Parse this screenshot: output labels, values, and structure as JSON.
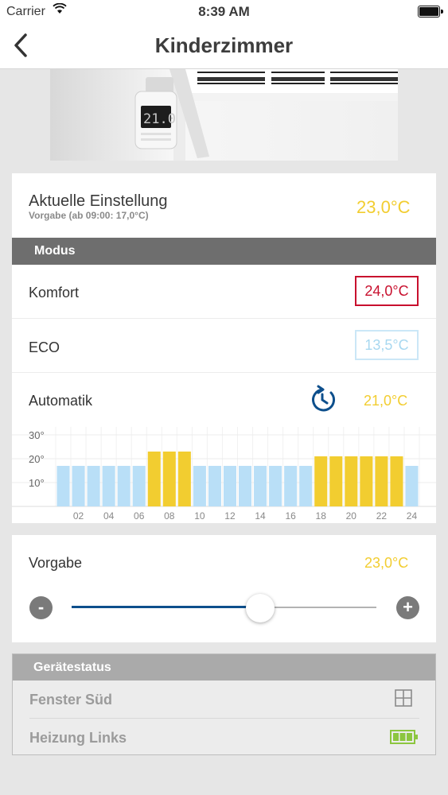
{
  "status_bar": {
    "carrier": "Carrier",
    "time": "8:39 AM"
  },
  "nav": {
    "title": "Kinderzimmer"
  },
  "current": {
    "title": "Aktuelle Einstellung",
    "subtitle": "Vorgabe (ab 09:00: 17,0°C)",
    "temp": "23,0°C"
  },
  "modus": {
    "header": "Modus",
    "komfort": {
      "label": "Komfort",
      "temp": "24,0°C"
    },
    "eco": {
      "label": "ECO",
      "temp": "13,5°C"
    },
    "automatik": {
      "label": "Automatik",
      "temp": "21,0°C"
    }
  },
  "chart_data": {
    "type": "bar",
    "ylabels": [
      "30°",
      "20°",
      "10°"
    ],
    "ylim": [
      0,
      30
    ],
    "categories": [
      "01",
      "02",
      "03",
      "04",
      "05",
      "06",
      "07",
      "08",
      "09",
      "10",
      "11",
      "12",
      "13",
      "14",
      "15",
      "16",
      "17",
      "18",
      "19",
      "20",
      "21",
      "22",
      "23",
      "24"
    ],
    "xtick_labels": [
      "02",
      "04",
      "06",
      "08",
      "10",
      "12",
      "14",
      "16",
      "18",
      "20",
      "22",
      "24"
    ],
    "values": [
      17,
      17,
      17,
      17,
      17,
      17,
      23,
      23,
      23,
      17,
      17,
      17,
      17,
      17,
      17,
      17,
      17,
      21,
      21,
      21,
      21,
      21,
      21,
      17
    ],
    "colors": [
      "#b9dff7",
      "#b9dff7",
      "#b9dff7",
      "#b9dff7",
      "#b9dff7",
      "#b9dff7",
      "#f2cd30",
      "#f2cd30",
      "#f2cd30",
      "#b9dff7",
      "#b9dff7",
      "#b9dff7",
      "#b9dff7",
      "#b9dff7",
      "#b9dff7",
      "#b9dff7",
      "#b9dff7",
      "#f2cd30",
      "#f2cd30",
      "#f2cd30",
      "#f2cd30",
      "#f2cd30",
      "#f2cd30",
      "#b9dff7"
    ]
  },
  "vorgabe": {
    "label": "Vorgabe",
    "temp": "23,0°C",
    "minus": "-",
    "plus": "+",
    "slider_fraction": 0.62
  },
  "geraetestatus": {
    "header": "Gerätestatus",
    "rows": [
      {
        "label": "Fenster Süd",
        "icon": "window-icon"
      },
      {
        "label": "Heizung Links",
        "icon": "battery-icon"
      }
    ]
  },
  "colors": {
    "yellow": "#f2cd30",
    "red": "#c8102e",
    "eco_blue": "#a8d8f0",
    "accent_blue": "#0d4f8c",
    "battery_green": "#8cc63f"
  }
}
